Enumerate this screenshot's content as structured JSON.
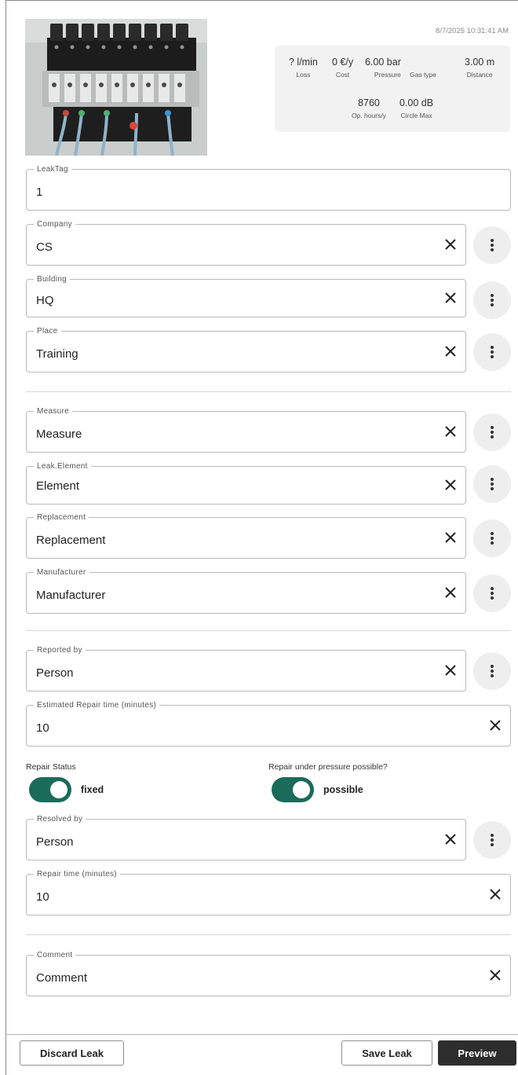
{
  "timestamp": "8/7/2025 10:31:41 AM",
  "metrics": {
    "loss": {
      "value": "? l/min",
      "label": "Loss"
    },
    "cost": {
      "value": "0 €/y",
      "label": "Cost"
    },
    "pressure": {
      "value": "6.00 bar",
      "label": "Pressure"
    },
    "gas_type": {
      "value": "",
      "label": "Gas type"
    },
    "distance": {
      "value": "3.00 m",
      "label": "Distance"
    },
    "op_hours": {
      "value": "8760",
      "label": "Op. hours/y"
    },
    "circle_max": {
      "value": "0.00 dB",
      "label": "Circle Max"
    }
  },
  "fields": {
    "leak_tag": {
      "label": "LeakTag",
      "value": "1"
    },
    "company": {
      "label": "Company",
      "value": "CS"
    },
    "building": {
      "label": "Building",
      "value": "HQ"
    },
    "place": {
      "label": "Place",
      "value": "Training"
    },
    "measure": {
      "label": "Measure",
      "value": "Measure"
    },
    "element": {
      "label": "Leak.Element",
      "value": "Element"
    },
    "replacement": {
      "label": "Replacement",
      "value": "Replacement"
    },
    "manufacturer": {
      "label": "Manufacturer",
      "value": "Manufacturer"
    },
    "reported_by": {
      "label": "Reported by",
      "value": "Person"
    },
    "est_repair_time": {
      "label": "Estimated Repair time (minutes)",
      "value": "10"
    },
    "resolved_by": {
      "label": "Resolved by",
      "value": "Person"
    },
    "repair_time": {
      "label": "Repair time (minutes)",
      "value": "10"
    },
    "comment": {
      "label": "Comment",
      "value": "Comment"
    }
  },
  "toggles": {
    "repair_status": {
      "label": "Repair Status",
      "state": "fixed",
      "on": true
    },
    "under_pressure": {
      "label": "Repair under pressure possible?",
      "state": "possible",
      "on": true
    }
  },
  "buttons": {
    "discard": "Discard Leak",
    "save": "Save Leak",
    "preview": "Preview"
  },
  "colors": {
    "toggle_on": "#1a6b5a",
    "primary_button": "#2d2d2d"
  },
  "icons": {
    "clear": "close-icon",
    "more": "more-vertical-icon"
  }
}
